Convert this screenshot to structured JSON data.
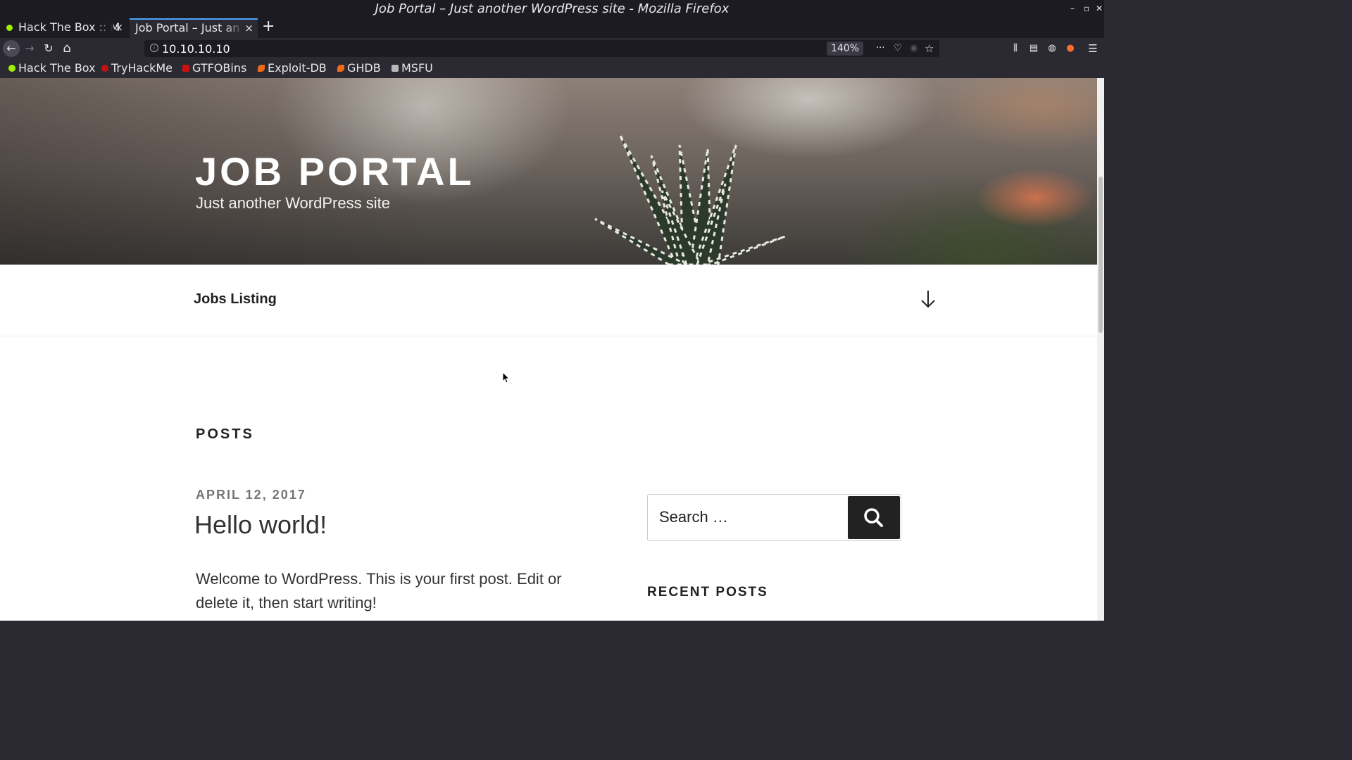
{
  "window": {
    "title": "Job Portal – Just another WordPress site - Mozilla Firefox",
    "controls": [
      "–",
      "▫",
      "✕"
    ]
  },
  "tabs": [
    {
      "label": "Hack The Box :: M",
      "close": "×"
    },
    {
      "label": "Job Portal – Just an",
      "close": "×"
    }
  ],
  "new_tab_label": "+",
  "toolbar": {
    "back": "←",
    "forward": "→",
    "reload": "↻",
    "home": "⌂",
    "url": "10.10.10.10",
    "info": "i",
    "zoom": "140%",
    "more": "···",
    "pocket": "♡",
    "shield": "◉",
    "bookmark_star": "☆",
    "library": "⫼",
    "sidebar": "▤",
    "account": "◍",
    "extension": "●",
    "menu": "☰"
  },
  "bookmarks": [
    {
      "label": "Hack The Box",
      "color": "#9fef00"
    },
    {
      "label": "TryHackMe",
      "color": "#c11111"
    },
    {
      "label": "GTFOBins",
      "color": "#cc1111"
    },
    {
      "label": "Exploit-DB",
      "color": "#ee6a1a"
    },
    {
      "label": "GHDB",
      "color": "#ee6a1a"
    },
    {
      "label": "MSFU",
      "color": "#b8b8b8"
    }
  ],
  "site": {
    "title": "JOB PORTAL",
    "description": "Just another WordPress site",
    "menu_item": "Jobs Listing"
  },
  "main": {
    "heading": "POSTS",
    "post": {
      "date": "APRIL 12, 2017",
      "title": "Hello world!",
      "excerpt": "Welcome to WordPress. This is your first post. Edit or delete it, then start writing!"
    }
  },
  "sidebar": {
    "search_placeholder": "Search …",
    "recent_heading": "RECENT POSTS"
  },
  "colors": {
    "browser_bg": "#2b2a33",
    "chrome_dark": "#1c1b22",
    "tab_accent": "#4da6ff",
    "page_text": "#222222",
    "date_text": "#767676"
  }
}
